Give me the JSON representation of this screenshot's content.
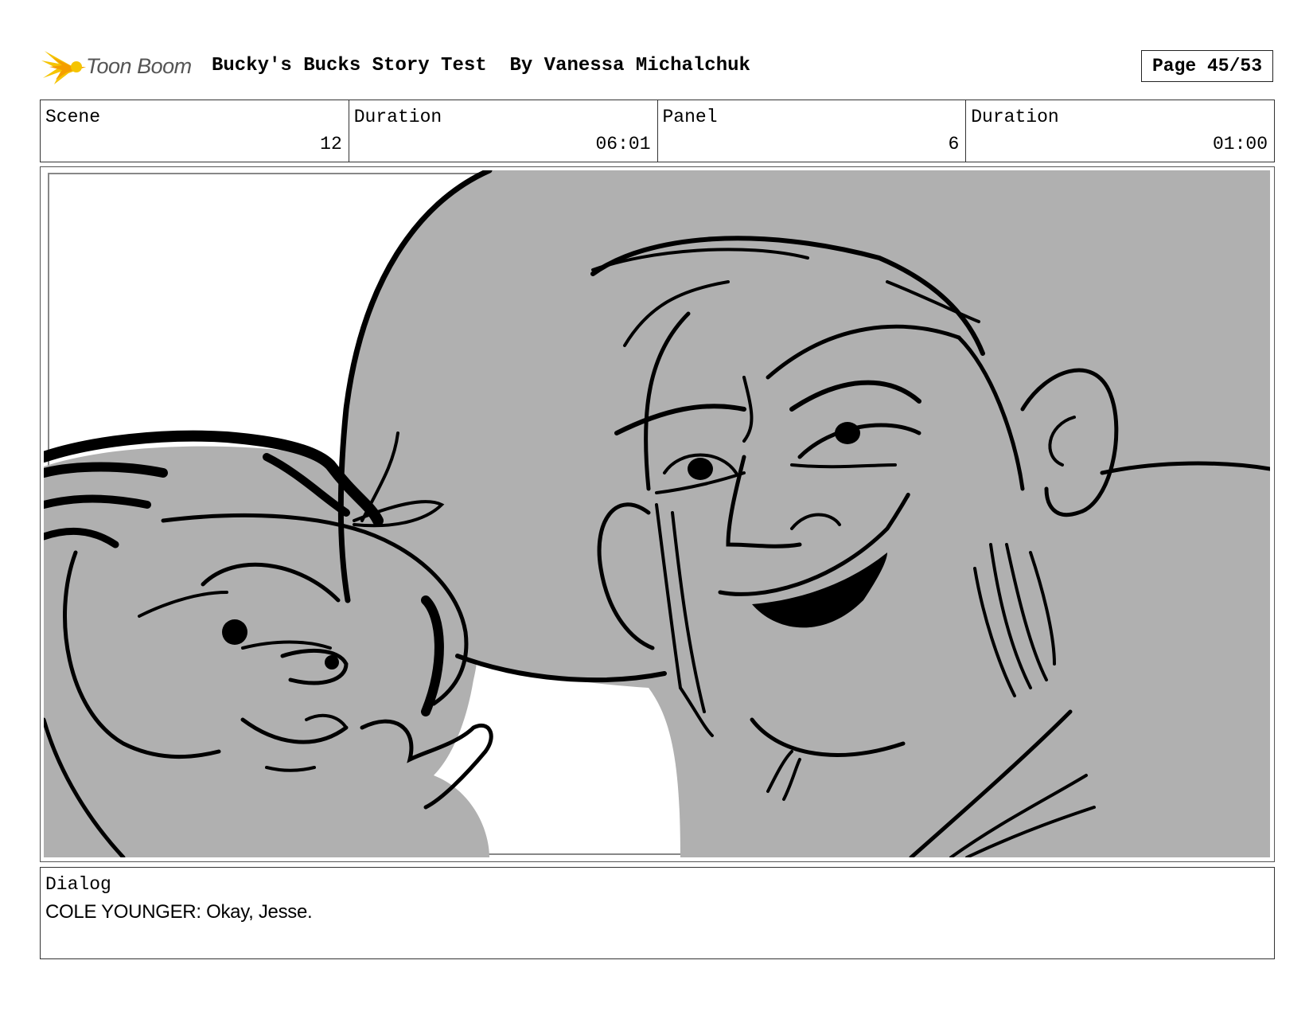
{
  "header": {
    "logo_text": "Toon Boom",
    "title": "Bucky's Bucks Story Test  By Vanessa Michalchuk",
    "page_label": "Page 45/53"
  },
  "info": {
    "scene_label": "Scene",
    "scene_value": "12",
    "scene_duration_label": "Duration",
    "scene_duration_value": "06:01",
    "panel_label": "Panel",
    "panel_value": "6",
    "panel_duration_label": "Duration",
    "panel_duration_value": "01:00"
  },
  "dialog": {
    "label": "Dialog",
    "text": "COLE YOUNGER: Okay, Jesse."
  },
  "colors": {
    "logo_yellow": "#F5C400",
    "logo_orange": "#F59E00",
    "sketch_gray": "#b0b0b0",
    "ink": "#000000"
  }
}
